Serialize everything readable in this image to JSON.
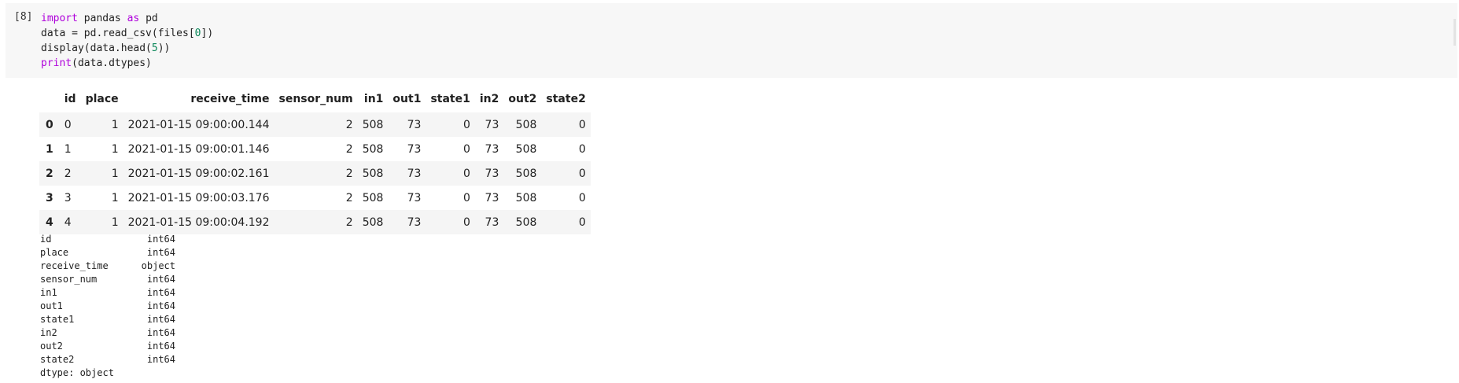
{
  "cell": {
    "execution_count": "[8]",
    "code_lines": [
      [
        {
          "t": "import",
          "c": "kw"
        },
        {
          "t": " pandas "
        },
        {
          "t": "as",
          "c": "kw"
        },
        {
          "t": " pd"
        }
      ],
      [
        {
          "t": "data = pd.read_csv(files["
        },
        {
          "t": "0",
          "c": "num"
        },
        {
          "t": "])"
        }
      ],
      [
        {
          "t": "display(data.head("
        },
        {
          "t": "5",
          "c": "num"
        },
        {
          "t": "))"
        }
      ],
      [
        {
          "t": "print",
          "c": "kw"
        },
        {
          "t": "(data.dtypes)"
        }
      ]
    ]
  },
  "dataframe": {
    "columns": [
      "",
      "id",
      "place",
      "receive_time",
      "sensor_num",
      "in1",
      "out1",
      "state1",
      "in2",
      "out2",
      "state2"
    ],
    "rows": [
      {
        "index": "0",
        "cells": [
          "0",
          "1",
          "2021-01-15 09:00:00.144",
          "2",
          "508",
          "73",
          "0",
          "73",
          "508",
          "0"
        ]
      },
      {
        "index": "1",
        "cells": [
          "1",
          "1",
          "2021-01-15 09:00:01.146",
          "2",
          "508",
          "73",
          "0",
          "73",
          "508",
          "0"
        ]
      },
      {
        "index": "2",
        "cells": [
          "2",
          "1",
          "2021-01-15 09:00:02.161",
          "2",
          "508",
          "73",
          "0",
          "73",
          "508",
          "0"
        ]
      },
      {
        "index": "3",
        "cells": [
          "3",
          "1",
          "2021-01-15 09:00:03.176",
          "2",
          "508",
          "73",
          "0",
          "73",
          "508",
          "0"
        ]
      },
      {
        "index": "4",
        "cells": [
          "4",
          "1",
          "2021-01-15 09:00:04.192",
          "2",
          "508",
          "73",
          "0",
          "73",
          "508",
          "0"
        ]
      }
    ]
  },
  "dtypes": {
    "rows": [
      {
        "name": "id",
        "type": "int64"
      },
      {
        "name": "place",
        "type": "int64"
      },
      {
        "name": "receive_time",
        "type": "object"
      },
      {
        "name": "sensor_num",
        "type": "int64"
      },
      {
        "name": "in1",
        "type": "int64"
      },
      {
        "name": "out1",
        "type": "int64"
      },
      {
        "name": "state1",
        "type": "int64"
      },
      {
        "name": "in2",
        "type": "int64"
      },
      {
        "name": "out2",
        "type": "int64"
      },
      {
        "name": "state2",
        "type": "int64"
      }
    ],
    "footer": "dtype: object"
  },
  "colors": {
    "keyword": "#af00db",
    "number": "#098658",
    "cell_background": "#f7f7f7",
    "row_stripe": "#f5f5f5"
  }
}
